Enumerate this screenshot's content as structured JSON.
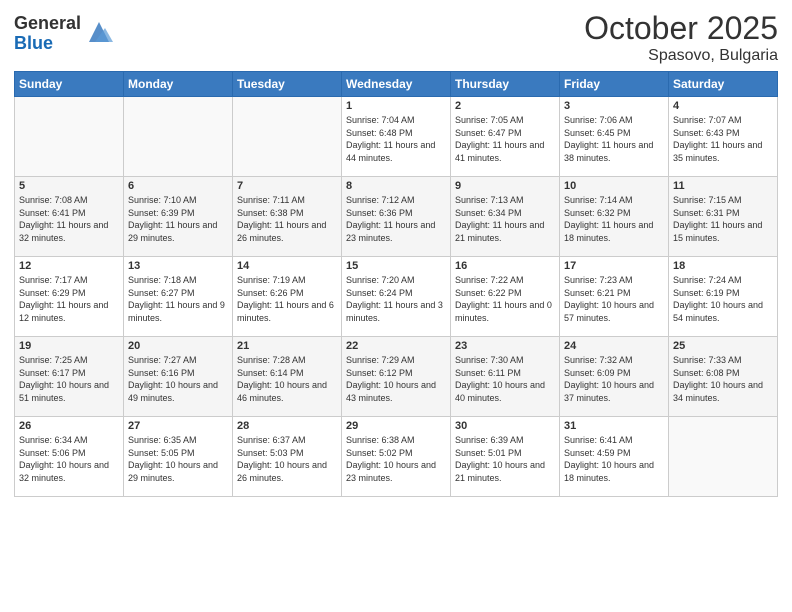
{
  "header": {
    "logo_general": "General",
    "logo_blue": "Blue",
    "month_year": "October 2025",
    "location": "Spasovo, Bulgaria"
  },
  "weekdays": [
    "Sunday",
    "Monday",
    "Tuesday",
    "Wednesday",
    "Thursday",
    "Friday",
    "Saturday"
  ],
  "weeks": [
    [
      {
        "day": "",
        "sunrise": "",
        "sunset": "",
        "daylight": ""
      },
      {
        "day": "",
        "sunrise": "",
        "sunset": "",
        "daylight": ""
      },
      {
        "day": "",
        "sunrise": "",
        "sunset": "",
        "daylight": ""
      },
      {
        "day": "1",
        "sunrise": "Sunrise: 7:04 AM",
        "sunset": "Sunset: 6:48 PM",
        "daylight": "Daylight: 11 hours and 44 minutes."
      },
      {
        "day": "2",
        "sunrise": "Sunrise: 7:05 AM",
        "sunset": "Sunset: 6:47 PM",
        "daylight": "Daylight: 11 hours and 41 minutes."
      },
      {
        "day": "3",
        "sunrise": "Sunrise: 7:06 AM",
        "sunset": "Sunset: 6:45 PM",
        "daylight": "Daylight: 11 hours and 38 minutes."
      },
      {
        "day": "4",
        "sunrise": "Sunrise: 7:07 AM",
        "sunset": "Sunset: 6:43 PM",
        "daylight": "Daylight: 11 hours and 35 minutes."
      }
    ],
    [
      {
        "day": "5",
        "sunrise": "Sunrise: 7:08 AM",
        "sunset": "Sunset: 6:41 PM",
        "daylight": "Daylight: 11 hours and 32 minutes."
      },
      {
        "day": "6",
        "sunrise": "Sunrise: 7:10 AM",
        "sunset": "Sunset: 6:39 PM",
        "daylight": "Daylight: 11 hours and 29 minutes."
      },
      {
        "day": "7",
        "sunrise": "Sunrise: 7:11 AM",
        "sunset": "Sunset: 6:38 PM",
        "daylight": "Daylight: 11 hours and 26 minutes."
      },
      {
        "day": "8",
        "sunrise": "Sunrise: 7:12 AM",
        "sunset": "Sunset: 6:36 PM",
        "daylight": "Daylight: 11 hours and 23 minutes."
      },
      {
        "day": "9",
        "sunrise": "Sunrise: 7:13 AM",
        "sunset": "Sunset: 6:34 PM",
        "daylight": "Daylight: 11 hours and 21 minutes."
      },
      {
        "day": "10",
        "sunrise": "Sunrise: 7:14 AM",
        "sunset": "Sunset: 6:32 PM",
        "daylight": "Daylight: 11 hours and 18 minutes."
      },
      {
        "day": "11",
        "sunrise": "Sunrise: 7:15 AM",
        "sunset": "Sunset: 6:31 PM",
        "daylight": "Daylight: 11 hours and 15 minutes."
      }
    ],
    [
      {
        "day": "12",
        "sunrise": "Sunrise: 7:17 AM",
        "sunset": "Sunset: 6:29 PM",
        "daylight": "Daylight: 11 hours and 12 minutes."
      },
      {
        "day": "13",
        "sunrise": "Sunrise: 7:18 AM",
        "sunset": "Sunset: 6:27 PM",
        "daylight": "Daylight: 11 hours and 9 minutes."
      },
      {
        "day": "14",
        "sunrise": "Sunrise: 7:19 AM",
        "sunset": "Sunset: 6:26 PM",
        "daylight": "Daylight: 11 hours and 6 minutes."
      },
      {
        "day": "15",
        "sunrise": "Sunrise: 7:20 AM",
        "sunset": "Sunset: 6:24 PM",
        "daylight": "Daylight: 11 hours and 3 minutes."
      },
      {
        "day": "16",
        "sunrise": "Sunrise: 7:22 AM",
        "sunset": "Sunset: 6:22 PM",
        "daylight": "Daylight: 11 hours and 0 minutes."
      },
      {
        "day": "17",
        "sunrise": "Sunrise: 7:23 AM",
        "sunset": "Sunset: 6:21 PM",
        "daylight": "Daylight: 10 hours and 57 minutes."
      },
      {
        "day": "18",
        "sunrise": "Sunrise: 7:24 AM",
        "sunset": "Sunset: 6:19 PM",
        "daylight": "Daylight: 10 hours and 54 minutes."
      }
    ],
    [
      {
        "day": "19",
        "sunrise": "Sunrise: 7:25 AM",
        "sunset": "Sunset: 6:17 PM",
        "daylight": "Daylight: 10 hours and 51 minutes."
      },
      {
        "day": "20",
        "sunrise": "Sunrise: 7:27 AM",
        "sunset": "Sunset: 6:16 PM",
        "daylight": "Daylight: 10 hours and 49 minutes."
      },
      {
        "day": "21",
        "sunrise": "Sunrise: 7:28 AM",
        "sunset": "Sunset: 6:14 PM",
        "daylight": "Daylight: 10 hours and 46 minutes."
      },
      {
        "day": "22",
        "sunrise": "Sunrise: 7:29 AM",
        "sunset": "Sunset: 6:12 PM",
        "daylight": "Daylight: 10 hours and 43 minutes."
      },
      {
        "day": "23",
        "sunrise": "Sunrise: 7:30 AM",
        "sunset": "Sunset: 6:11 PM",
        "daylight": "Daylight: 10 hours and 40 minutes."
      },
      {
        "day": "24",
        "sunrise": "Sunrise: 7:32 AM",
        "sunset": "Sunset: 6:09 PM",
        "daylight": "Daylight: 10 hours and 37 minutes."
      },
      {
        "day": "25",
        "sunrise": "Sunrise: 7:33 AM",
        "sunset": "Sunset: 6:08 PM",
        "daylight": "Daylight: 10 hours and 34 minutes."
      }
    ],
    [
      {
        "day": "26",
        "sunrise": "Sunrise: 6:34 AM",
        "sunset": "Sunset: 5:06 PM",
        "daylight": "Daylight: 10 hours and 32 minutes."
      },
      {
        "day": "27",
        "sunrise": "Sunrise: 6:35 AM",
        "sunset": "Sunset: 5:05 PM",
        "daylight": "Daylight: 10 hours and 29 minutes."
      },
      {
        "day": "28",
        "sunrise": "Sunrise: 6:37 AM",
        "sunset": "Sunset: 5:03 PM",
        "daylight": "Daylight: 10 hours and 26 minutes."
      },
      {
        "day": "29",
        "sunrise": "Sunrise: 6:38 AM",
        "sunset": "Sunset: 5:02 PM",
        "daylight": "Daylight: 10 hours and 23 minutes."
      },
      {
        "day": "30",
        "sunrise": "Sunrise: 6:39 AM",
        "sunset": "Sunset: 5:01 PM",
        "daylight": "Daylight: 10 hours and 21 minutes."
      },
      {
        "day": "31",
        "sunrise": "Sunrise: 6:41 AM",
        "sunset": "Sunset: 4:59 PM",
        "daylight": "Daylight: 10 hours and 18 minutes."
      },
      {
        "day": "",
        "sunrise": "",
        "sunset": "",
        "daylight": ""
      }
    ]
  ]
}
